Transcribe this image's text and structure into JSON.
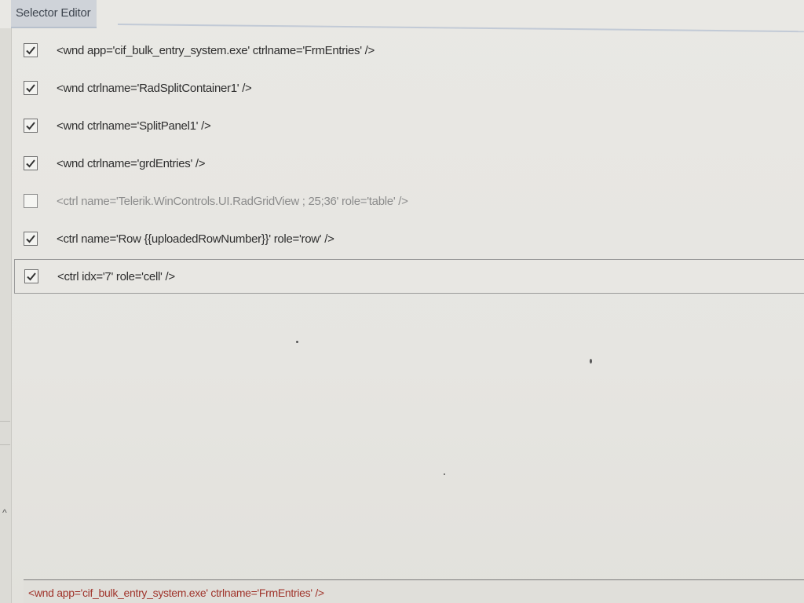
{
  "window": {
    "title": "Selector Editor"
  },
  "selector_lines": [
    {
      "text": "<wnd app='cif_bulk_entry_system.exe' ctrlname='FrmEntries' />",
      "checked": true
    },
    {
      "text": "<wnd ctrlname='RadSplitContainer1' />",
      "checked": true
    },
    {
      "text": "<wnd ctrlname='SplitPanel1' />",
      "checked": true
    },
    {
      "text": "<wnd ctrlname='grdEntries' />",
      "checked": true
    },
    {
      "text": "<ctrl name='Telerik.WinControls.UI.RadGridView ; 25;36' role='table' />",
      "checked": false
    },
    {
      "text": "<ctrl name='Row {{uploadedRowNumber}}' role='row' />",
      "checked": true
    },
    {
      "text": "<ctrl idx='7' role='cell' />",
      "checked": true
    }
  ],
  "selected_index": 6,
  "preview": {
    "text": "<wnd app='cif_bulk_entry_system.exe' ctrlname='FrmEntries' />"
  },
  "colors": {
    "preview_text": "#a0352c",
    "checkmark": "#333333"
  }
}
